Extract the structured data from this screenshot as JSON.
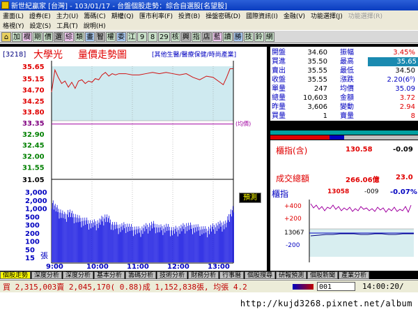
{
  "window": {
    "title": "新世紀贏家 [台灣] - 103/01/17 - 台盤個股走勢：綜合自選股[名望股]"
  },
  "menu": {
    "row1": [
      "畫面(L)",
      "證券(E)",
      "主力(U)",
      "籌碼(C)",
      "期權(Q)",
      "匯市利率(F)",
      "投資(B)",
      "操盤密碼(D)",
      "國際資訊(I)",
      "金融(V)",
      "功能選擇(J)",
      "功能選擇(R)"
    ],
    "row1_disabled": [
      false,
      false,
      false,
      false,
      false,
      false,
      false,
      false,
      false,
      false,
      false,
      true
    ],
    "row2": [
      "格視(Y)",
      "設定(S)",
      "工具(T)",
      "說明(H)"
    ]
  },
  "toolbar": {
    "buttons": [
      "加",
      "欄",
      "期",
      "價",
      "選",
      "綜",
      "類",
      "畫",
      "智",
      "權",
      "委",
      "江",
      "9",
      "8",
      "29",
      "核",
      "興",
      "指",
      "店",
      "藍",
      "讀",
      "勝",
      "技",
      "鈴",
      "網"
    ]
  },
  "stock": {
    "code": "[3218]",
    "name": "大學光",
    "chart_title": "量價走勢圖",
    "category": "[其他生醫/醫療保健/時尚產業]",
    "label_avg": "(均價)",
    "forecast_button": "預測",
    "volume_unit": "張"
  },
  "quote": {
    "rows": [
      {
        "l": "開盤",
        "lv": "34.60",
        "r": "振幅",
        "rv": "3.45%",
        "rvColor": "#e00000"
      },
      {
        "l": "買進",
        "lv": "35.50",
        "r": "最高",
        "rv": "35.65",
        "rvColor": "#ffffff",
        "rvBg": "#1a8ab0"
      },
      {
        "l": "賣出",
        "lv": "35.55",
        "r": "最低",
        "rv": "34.50",
        "rvColor": "#000000"
      },
      {
        "l": "收盤",
        "lv": "35.55",
        "r": "漲跌",
        "rv": "2.20(6⁰)",
        "rvColor": "#0000c0"
      },
      {
        "l": "單量",
        "lv": "247",
        "r": "均價",
        "rv": "35.09",
        "rvColor": "#0000c0"
      },
      {
        "l": "總量",
        "lv": "10,603",
        "r": "金額",
        "rv": "3.72",
        "rvColor": "#e00000"
      },
      {
        "l": "昨量",
        "lv": "3,606",
        "r": "變動",
        "rv": "2.94",
        "rvColor": "#e00000"
      },
      {
        "l": "買量",
        "lv": "1",
        "r": "賣量",
        "rv": "8",
        "rvColor": "#e00000"
      }
    ]
  },
  "index_panel": {
    "label": "櫃指(含)",
    "value": "130.58",
    "change": "-0.09",
    "turnover_label": "成交總額",
    "turnover": "266.06億",
    "turnover_change": "23.0"
  },
  "mini_index": {
    "label": "櫃指",
    "value": "13058",
    "change": "-009",
    "pct": "-0.07%",
    "plus400": "+400",
    "plus200": "+200",
    "level": "13067",
    "minus200": "-200"
  },
  "tabs": [
    "個股走勢",
    "深度分析",
    "深度分析",
    "基本分析",
    "籌碼分析",
    "技術分析",
    "財務分析",
    "行事曆",
    "個股搜尋",
    "研報預測",
    "個股新聞",
    "產業分析"
  ],
  "status": {
    "text": "買 2,315,003賣 2,045,170( 0.88)成 1,152,838張, 均張 4.2",
    "code": "001",
    "time": "14:00:20/"
  },
  "watermark": "http://kujd3268.pixnet.net/album",
  "colors": {
    "price_line": "#d01010",
    "avg_line": "#a000a0",
    "up": "#e00000",
    "down": "#0000c0",
    "volume": "#1010e0"
  },
  "chart_data": {
    "type": "line",
    "x_ticks": [
      "9:00",
      "10:00",
      "11:00",
      "12:00",
      "13:00"
    ],
    "price_ticks": [
      "35.65",
      "35.15",
      "34.70",
      "34.25",
      "33.80",
      "33.35",
      "32.90",
      "32.45",
      "32.00",
      "31.55",
      "31.05"
    ],
    "volume_ticks": [
      "3,000",
      "2,000",
      "1,000",
      "500",
      "300",
      "200",
      "100",
      "50",
      "15"
    ],
    "reference_price": 33.35,
    "price_ylim": [
      31.05,
      35.65
    ],
    "volume_max": 3000,
    "series": [
      {
        "name": "price",
        "x": [
          0,
          5,
          10,
          15,
          20,
          25,
          30,
          35,
          40,
          45,
          50,
          55,
          60,
          65,
          70,
          75,
          80,
          85,
          90,
          95,
          100,
          110,
          120,
          130,
          140,
          150,
          160,
          170,
          180,
          190,
          200,
          210,
          220,
          230,
          240,
          250,
          255,
          260,
          265,
          270
        ],
        "values": [
          34.6,
          35.5,
          35.2,
          34.95,
          35.05,
          34.8,
          35.0,
          34.75,
          35.05,
          35.1,
          34.95,
          35.05,
          35.0,
          35.15,
          35.1,
          35.3,
          35.4,
          35.25,
          35.35,
          35.3,
          35.35,
          35.35,
          35.3,
          35.3,
          35.35,
          35.4,
          35.35,
          35.4,
          35.35,
          35.3,
          35.35,
          35.2,
          35.1,
          35.25,
          35.2,
          35.0,
          34.9,
          35.2,
          35.55,
          35.55
        ]
      },
      {
        "name": "average",
        "x": [
          0,
          270
        ],
        "values": [
          33.3,
          33.3
        ]
      }
    ],
    "volume": {
      "x": [
        0,
        5,
        10,
        15,
        20,
        25,
        30,
        40,
        50,
        60,
        70,
        80,
        90,
        100,
        110,
        120,
        130,
        140,
        150,
        160,
        170,
        180,
        190,
        200,
        210,
        220,
        230,
        240,
        250,
        260,
        265,
        270
      ],
      "values": [
        1200,
        600,
        400,
        300,
        200,
        350,
        250,
        150,
        120,
        90,
        100,
        200,
        80,
        60,
        70,
        50,
        40,
        60,
        80,
        50,
        60,
        40,
        50,
        70,
        60,
        50,
        40,
        60,
        80,
        90,
        300,
        500
      ]
    }
  }
}
